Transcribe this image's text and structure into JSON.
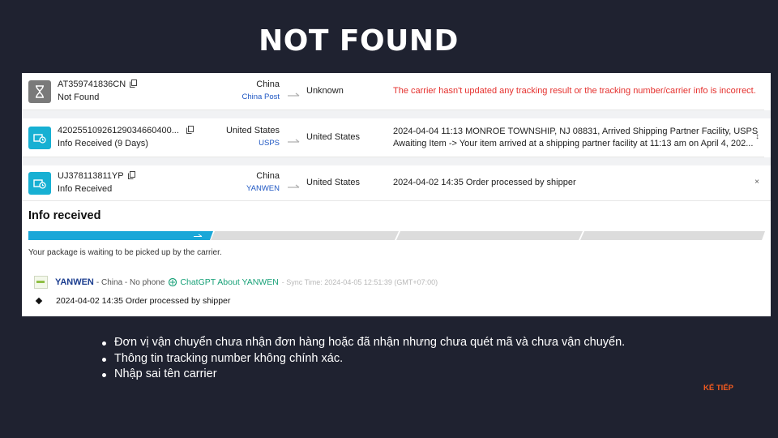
{
  "slide": {
    "title": "NOT FOUND",
    "bullets": [
      "Đơn vị vận chuyển chưa nhận đơn hàng hoặc đã nhận nhưng chưa quét mã và chưa vận chuyển.",
      "Thông tin tracking number không chính xác.",
      "Nhập sai tên carrier"
    ],
    "next_label": "KẾ TIẾP"
  },
  "shipments": [
    {
      "tracking_number": "AT359741836CN",
      "status": "Not Found",
      "origin_country": "China",
      "carrier": "China Post",
      "destination": "Unknown",
      "event": "The carrier hasn't updated any tracking result or the tracking number/carrier info is incorrect.",
      "icon": "hourglass-icon"
    },
    {
      "tracking_number": "4202551092612903466040​0...",
      "status": "Info Received (9 Days)",
      "origin_country": "United States",
      "carrier": "USPS",
      "destination": "United States",
      "event_line1": "2024-04-04 11:13  MONROE TOWNSHIP, NJ 08831, Arrived Shipping Partner Facility, USPS",
      "event_line2": "Awaiting Item -> Your item arrived at a shipping partner facility at 11:13 am on April 4, 202...",
      "icon": "info-received-icon"
    },
    {
      "tracking_number": "UJ378113811YP",
      "status": "Info Received",
      "origin_country": "China",
      "carrier": "YANWEN",
      "destination": "United States",
      "event": "2024-04-02 14:35  Order processed by shipper",
      "icon": "info-received-icon"
    }
  ],
  "detail": {
    "heading": "Info received",
    "progress": {
      "steps": 4,
      "completed_fraction": 0.25,
      "active_color": "#1aa7d8",
      "inactive_color": "#dcdcdc"
    },
    "waiting_text": "Your package is waiting to be picked up by the carrier.",
    "carrier_name": "YANWEN",
    "carrier_meta": "- China - No phone",
    "gpt_link": "ChatGPT About YANWEN",
    "sync_time": "- Sync Time: 2024-04-05 12:51:39 (GMT+07:00)",
    "event": "2024-04-02 14:35  Order processed by shipper"
  },
  "colors": {
    "background": "#1f2230",
    "error": "#e5302d",
    "carrier_link": "#1f57c3",
    "next_button": "#f25a1f"
  }
}
